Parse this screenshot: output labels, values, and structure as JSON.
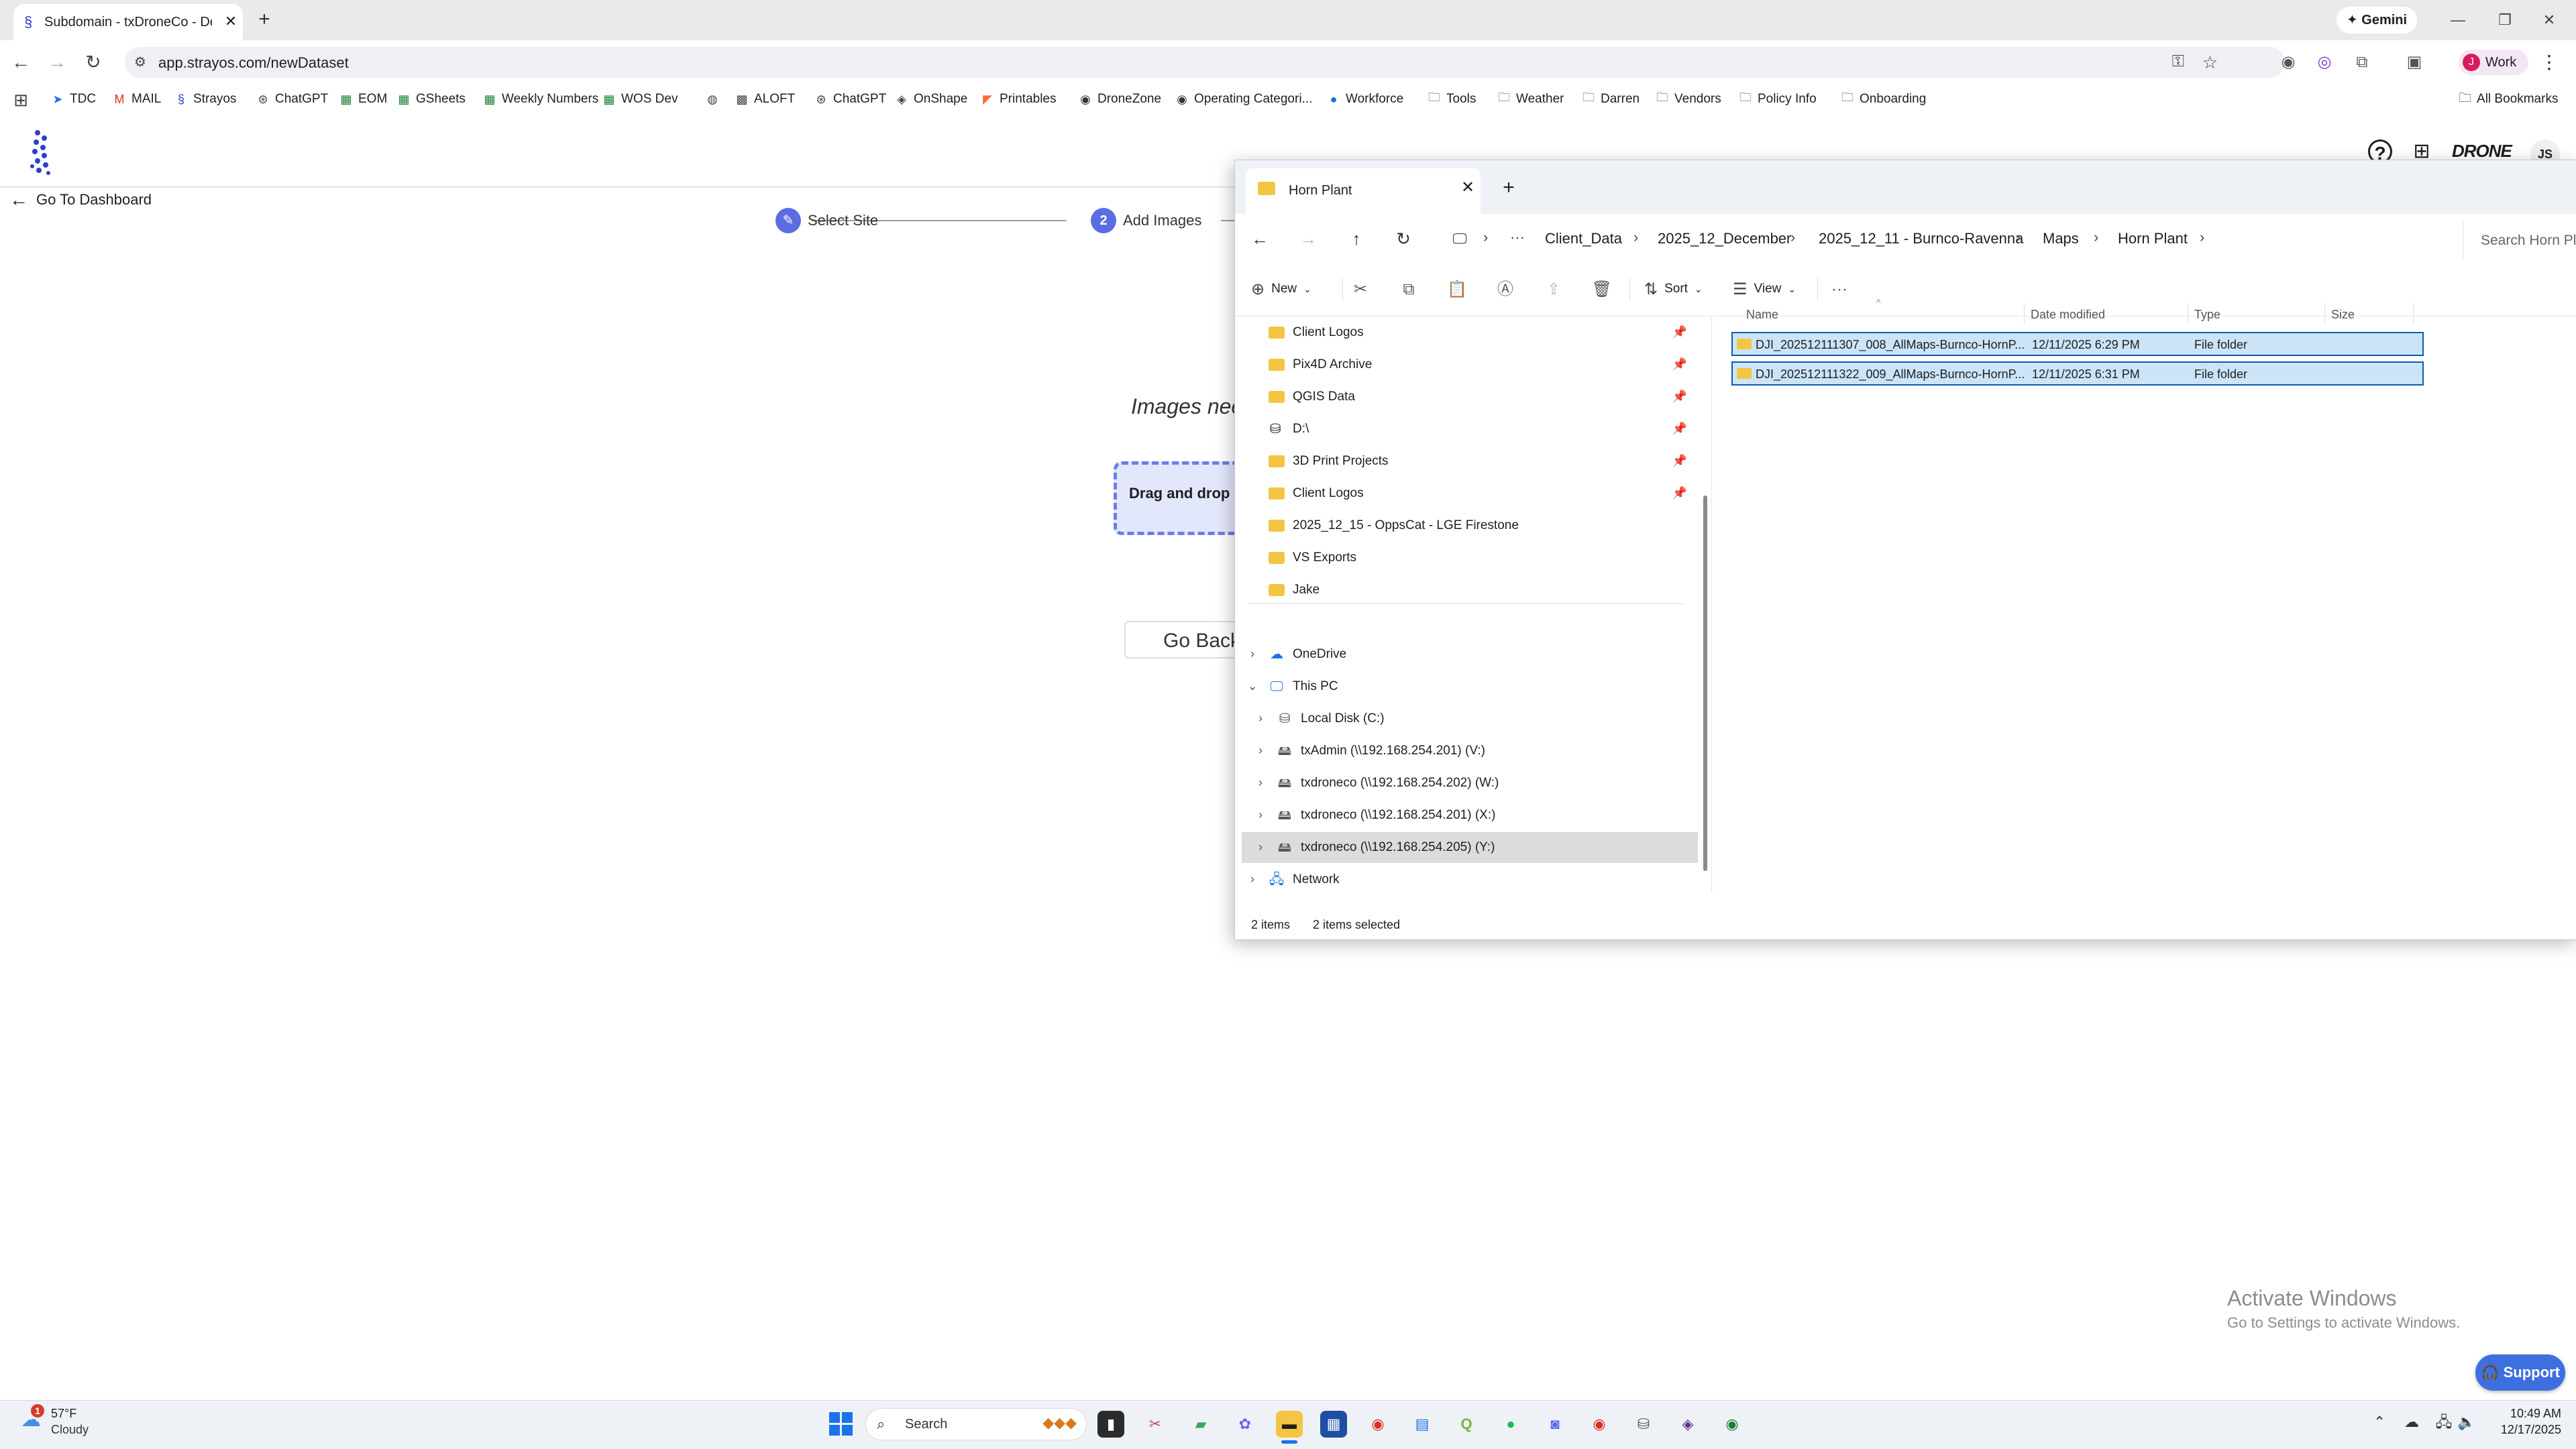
{
  "browser": {
    "tab": {
      "title": "Subdomain - txDroneCo - Demo"
    },
    "gemini_label": "Gemini",
    "url": "app.strayos.com/newDataset",
    "profile_label": "Work",
    "profile_initial": "J",
    "bookmarks": [
      {
        "label": "TDC",
        "icon": "send-icon"
      },
      {
        "label": "MAIL",
        "icon": "gmail-icon"
      },
      {
        "label": "Strayos",
        "icon": "strayos-icon"
      },
      {
        "label": "ChatGPT",
        "icon": "chatgpt-icon"
      },
      {
        "label": "EOM",
        "icon": "sheets-icon"
      },
      {
        "label": "GSheets",
        "icon": "sheets-icon"
      },
      {
        "label": "Weekly Numbers",
        "icon": "sheets-icon"
      },
      {
        "label": "WOS Dev",
        "icon": "sheets-icon"
      },
      {
        "label": "",
        "icon": "globe-icon"
      },
      {
        "label": "ALOFT",
        "icon": "aloft-icon"
      },
      {
        "label": "ChatGPT",
        "icon": "chatgpt-icon"
      },
      {
        "label": "OnShape",
        "icon": "onshape-icon"
      },
      {
        "label": "Printables",
        "icon": "printables-icon"
      },
      {
        "label": "DroneZone",
        "icon": "faa-icon"
      },
      {
        "label": "Operating Categori...",
        "icon": "faa-icon"
      },
      {
        "label": "Workforce",
        "icon": "workforce-icon"
      },
      {
        "label": "Tools",
        "icon": "folder-icon"
      },
      {
        "label": "Weather",
        "icon": "folder-icon"
      },
      {
        "label": "Darren",
        "icon": "folder-icon"
      },
      {
        "label": "Vendors",
        "icon": "folder-icon"
      },
      {
        "label": "Policy Info",
        "icon": "folder-icon"
      },
      {
        "label": "Onboarding",
        "icon": "folder-icon"
      }
    ],
    "all_bookmarks_label": "All Bookmarks"
  },
  "app": {
    "brand": "DRONE",
    "user_initials": "JS",
    "go_dashboard": "Go To Dashboard",
    "steps": [
      {
        "number": "",
        "label": "Select Site"
      },
      {
        "number": "2",
        "label": "Add Images"
      }
    ],
    "images_need_text": "Images need",
    "dropzone_text": "Drag and drop files",
    "go_back": "Go Back",
    "activate_title": "Activate Windows",
    "activate_sub": "Go to Settings to activate Windows.",
    "support_label": "Support"
  },
  "explorer": {
    "tab_title": "Horn Plant",
    "breadcrumbs": [
      "Client_Data",
      "2025_12_December",
      "2025_12_11 - Burnco-Ravenna",
      "Maps",
      "Horn Plant"
    ],
    "search_placeholder": "Search Horn Plant",
    "commands": {
      "new": "New",
      "sort": "Sort",
      "view": "View"
    },
    "nav_items": [
      {
        "label": "Client Logos",
        "type": "folder",
        "pinned": true
      },
      {
        "label": "Pix4D Archive",
        "type": "folder",
        "pinned": true
      },
      {
        "label": "QGIS Data",
        "type": "folder",
        "pinned": true
      },
      {
        "label": "D:\\",
        "type": "drive",
        "pinned": true
      },
      {
        "label": "3D Print Projects",
        "type": "folder",
        "pinned": true
      },
      {
        "label": "Client Logos",
        "type": "folder",
        "pinned": true
      },
      {
        "label": "2025_12_15 - OppsCat - LGE Firestone",
        "type": "folder",
        "pinned": false
      },
      {
        "label": "VS Exports",
        "type": "folder",
        "pinned": false
      },
      {
        "label": "Jake",
        "type": "folder",
        "pinned": false
      }
    ],
    "tree_items": [
      {
        "label": "OneDrive",
        "icon": "onedrive-icon",
        "chevron": "›"
      },
      {
        "label": "This PC",
        "icon": "pc-icon",
        "chevron": "⌄"
      },
      {
        "label": "Local Disk (C:)",
        "icon": "disk-icon",
        "chevron": "›"
      },
      {
        "label": "txAdmin (\\\\192.168.254.201) (V:)",
        "icon": "network-drive-icon",
        "chevron": "›"
      },
      {
        "label": "txdroneco (\\\\192.168.254.202) (W:)",
        "icon": "network-drive-icon",
        "chevron": "›"
      },
      {
        "label": "txdroneco (\\\\192.168.254.201) (X:)",
        "icon": "network-drive-icon",
        "chevron": "›"
      },
      {
        "label": "txdroneco (\\\\192.168.254.205) (Y:)",
        "icon": "network-drive-icon",
        "chevron": "›"
      },
      {
        "label": "Network",
        "icon": "network-icon",
        "chevron": "›"
      }
    ],
    "columns": [
      "Name",
      "Date modified",
      "Type",
      "Size"
    ],
    "files": [
      {
        "name": "DJI_202512111307_008_AllMaps-Burnco-HornP...",
        "date": "12/11/2025 6:29 PM",
        "type": "File folder",
        "size": ""
      },
      {
        "name": "DJI_202512111322_009_AllMaps-Burnco-HornP...",
        "date": "12/11/2025 6:31 PM",
        "type": "File folder",
        "size": ""
      }
    ],
    "status": {
      "count": "2 items",
      "selected": "2 items selected"
    }
  },
  "taskbar": {
    "temp": "57°F",
    "condition": "Cloudy",
    "weather_badge": "1",
    "search_label": "Search",
    "time": "10:49 AM",
    "date": "12/17/2025"
  }
}
